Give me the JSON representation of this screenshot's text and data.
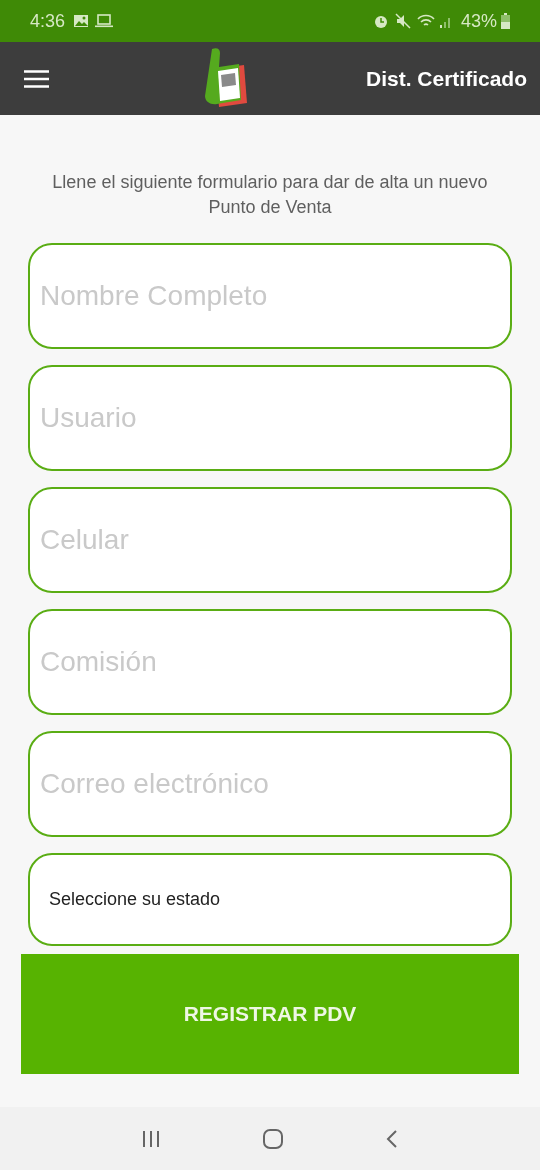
{
  "status_bar": {
    "time": "4:36",
    "battery": "43%"
  },
  "app_bar": {
    "title": "Dist. Certificado"
  },
  "intro": "Llene el siguiente formulario para dar de alta un nuevo Punto de Venta",
  "fields": [
    {
      "placeholder": "Nombre Completo"
    },
    {
      "placeholder": "Usuario"
    },
    {
      "placeholder": "Celular"
    },
    {
      "placeholder": "Comisión"
    },
    {
      "placeholder": "Correo electrónico"
    }
  ],
  "state_select": {
    "value": "Seleccione su estado"
  },
  "submit_button": "REGISTRAR PDV"
}
